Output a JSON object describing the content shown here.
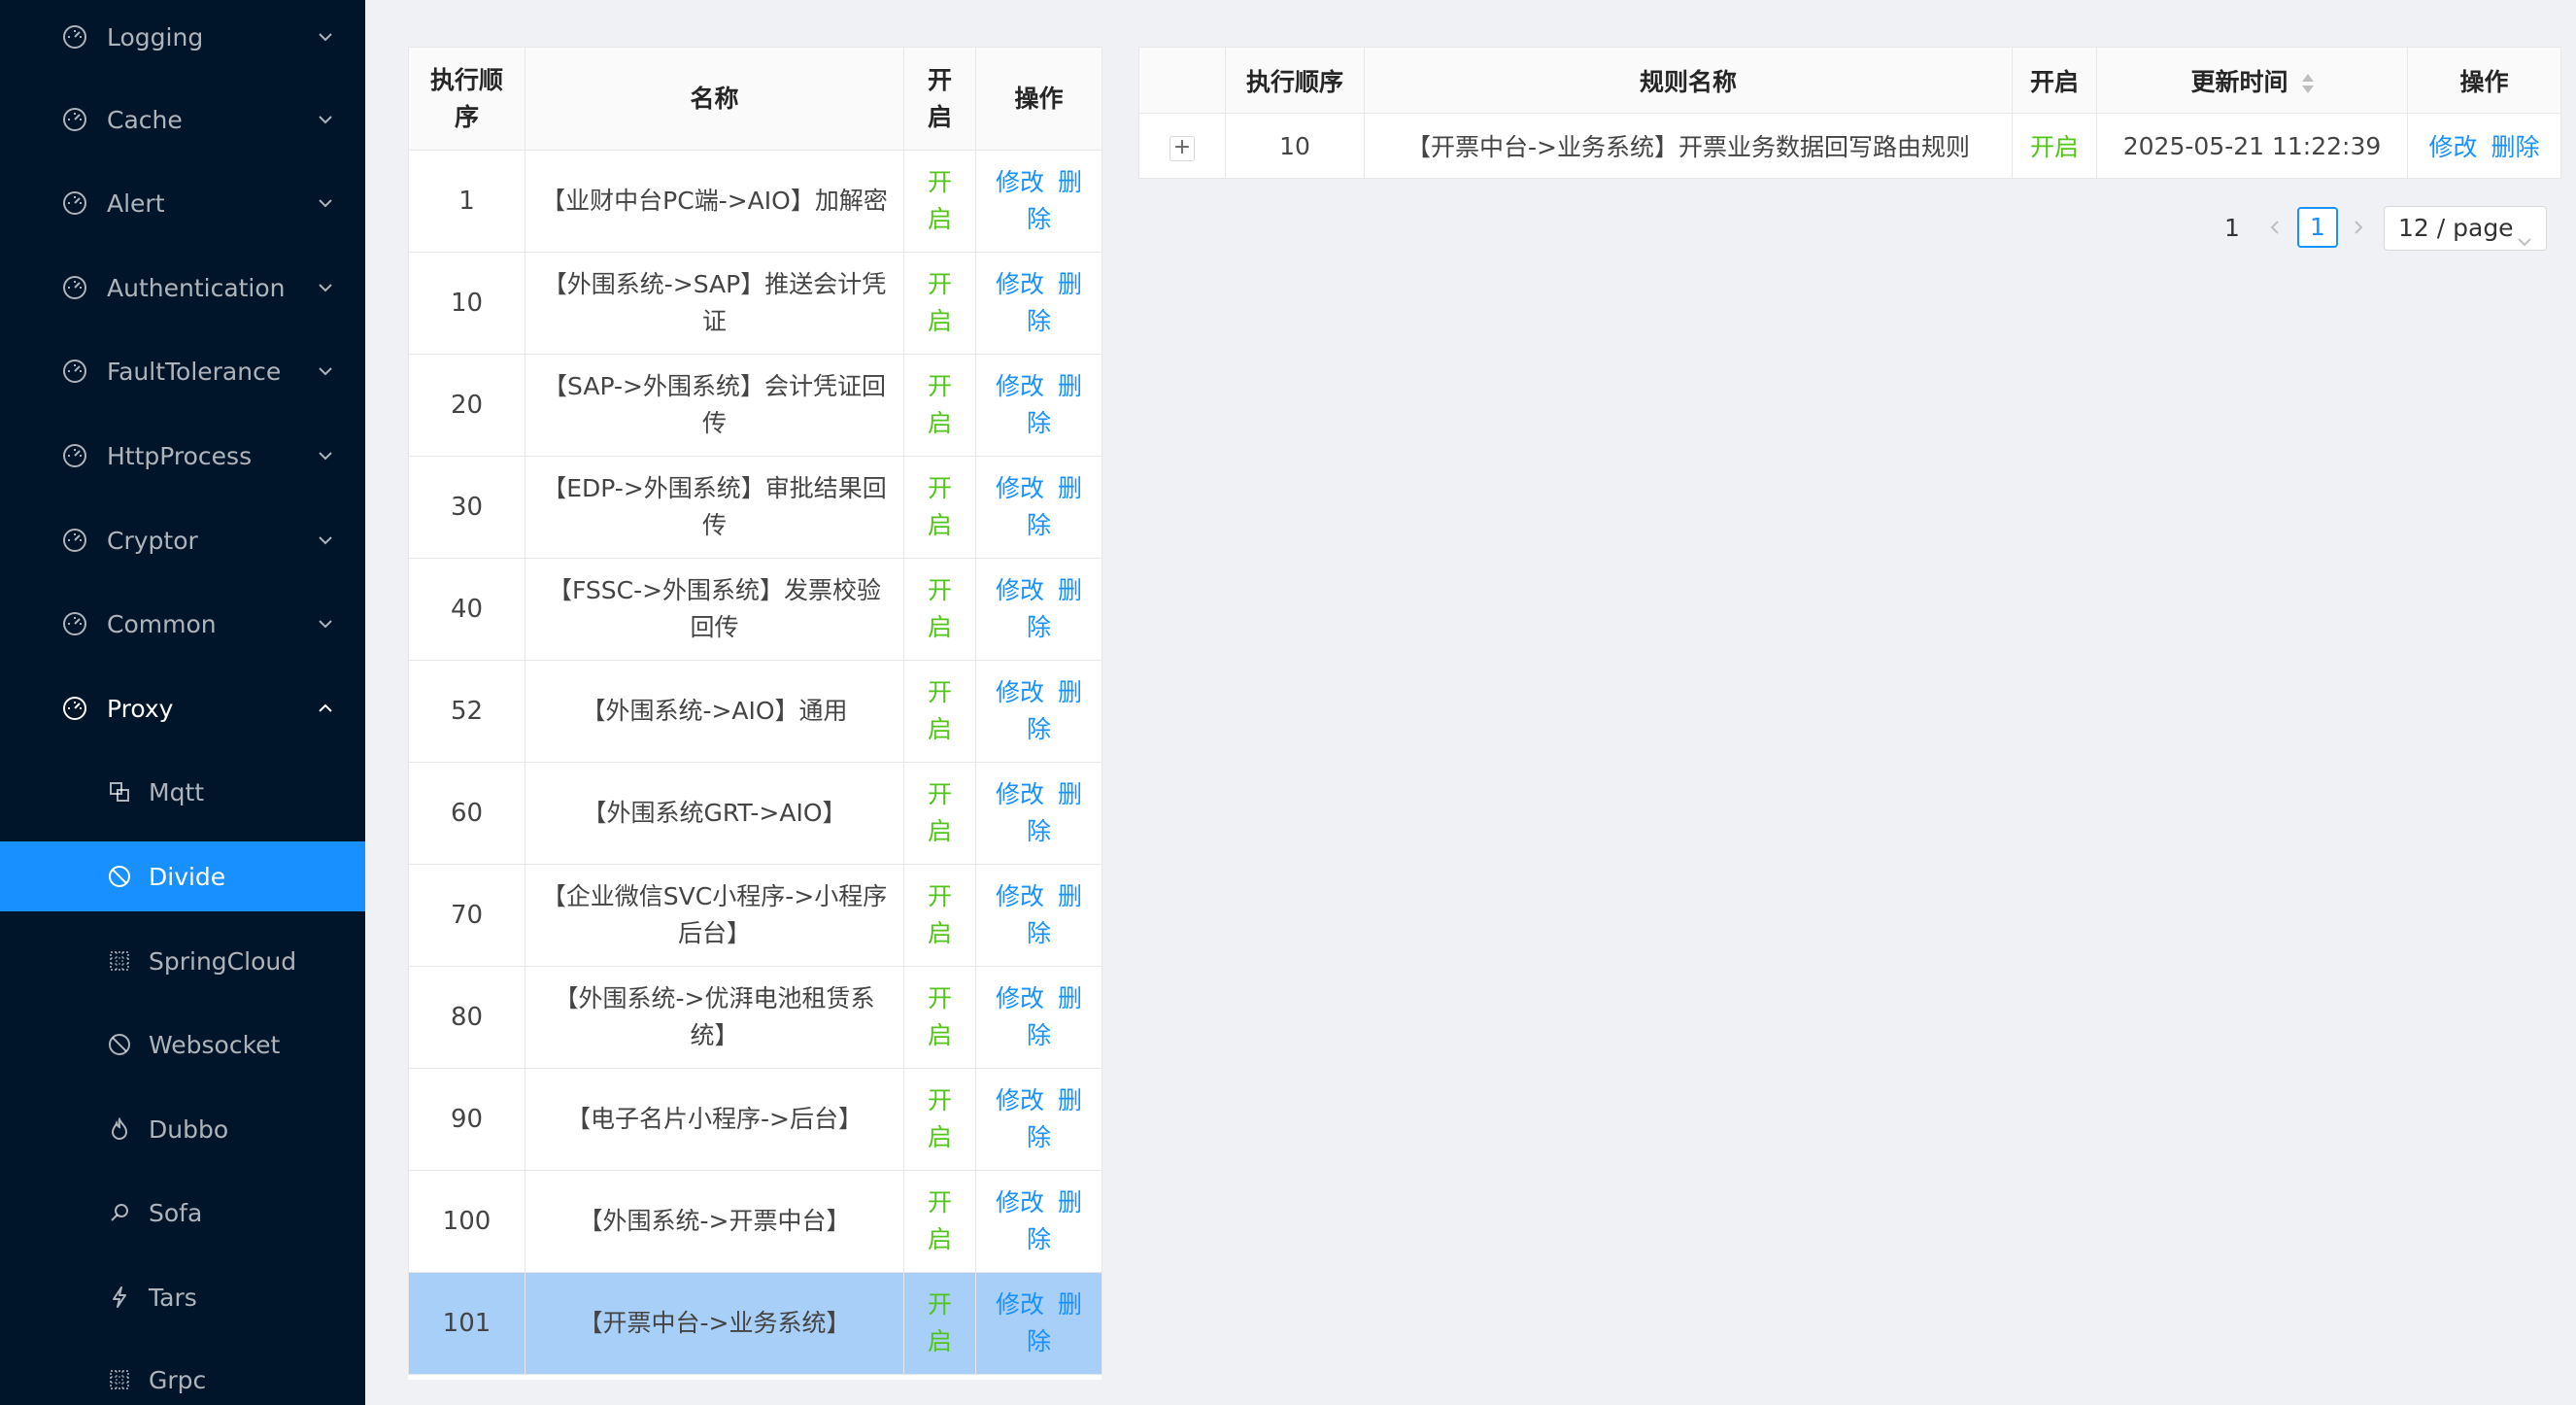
{
  "sidebar": {
    "items": [
      {
        "label": "Logging",
        "icon": "dashboard-icon"
      },
      {
        "label": "Cache",
        "icon": "dashboard-icon"
      },
      {
        "label": "Alert",
        "icon": "dashboard-icon"
      },
      {
        "label": "Authentication",
        "icon": "dashboard-icon"
      },
      {
        "label": "FaultTolerance",
        "icon": "dashboard-icon"
      },
      {
        "label": "HttpProcess",
        "icon": "dashboard-icon"
      },
      {
        "label": "Cryptor",
        "icon": "dashboard-icon"
      },
      {
        "label": "Common",
        "icon": "dashboard-icon"
      },
      {
        "label": "Proxy",
        "icon": "dashboard-icon",
        "expanded": true
      }
    ],
    "sub_items": [
      {
        "label": "Mqtt",
        "icon": "block-icon"
      },
      {
        "label": "Divide",
        "icon": "stop-icon",
        "selected": true
      },
      {
        "label": "SpringCloud",
        "icon": "grid-icon"
      },
      {
        "label": "Websocket",
        "icon": "stop-icon"
      },
      {
        "label": "Dubbo",
        "icon": "fire-icon"
      },
      {
        "label": "Sofa",
        "icon": "search-icon"
      },
      {
        "label": "Tars",
        "icon": "thunder-icon"
      },
      {
        "label": "Grpc",
        "icon": "grid-icon"
      }
    ],
    "colors": {
      "background": "#001529",
      "selected": "#1890ff"
    }
  },
  "selector_table": {
    "headers": {
      "order": "执行顺序",
      "name": "名称",
      "enabled": "开启",
      "actions": "操作"
    },
    "edit_label": "修改",
    "delete_label": "删除",
    "rows": [
      {
        "order": "1",
        "name": "【业财中台PC端->AIO】加解密",
        "enabled": "开启"
      },
      {
        "order": "10",
        "name": "【外围系统->SAP】推送会计凭证",
        "enabled": "开启"
      },
      {
        "order": "20",
        "name": "【SAP->外围系统】会计凭证回传",
        "enabled": "开启"
      },
      {
        "order": "30",
        "name": "【EDP->外围系统】审批结果回传",
        "enabled": "开启"
      },
      {
        "order": "40",
        "name": "【FSSC->外围系统】发票校验回传",
        "enabled": "开启"
      },
      {
        "order": "52",
        "name": "【外围系统->AIO】通用",
        "enabled": "开启"
      },
      {
        "order": "60",
        "name": "【外围系统GRT->AIO】",
        "enabled": "开启"
      },
      {
        "order": "70",
        "name": "【企业微信SVC小程序->小程序后台】",
        "enabled": "开启"
      },
      {
        "order": "80",
        "name": "【外围系统->优湃电池租赁系统】",
        "enabled": "开启"
      },
      {
        "order": "90",
        "name": "【电子名片小程序->后台】",
        "enabled": "开启"
      },
      {
        "order": "100",
        "name": "【外围系统->开票中台】",
        "enabled": "开启"
      },
      {
        "order": "101",
        "name": "【开票中台->业务系统】",
        "enabled": "开启",
        "selected": true
      }
    ]
  },
  "rule_table": {
    "headers": {
      "order": "执行顺序",
      "name": "规则名称",
      "enabled": "开启",
      "updated": "更新时间",
      "actions": "操作"
    },
    "expand_label": "+",
    "rows": [
      {
        "order": "10",
        "name": "【开票中台->业务系统】开票业务数据回写路由规则",
        "enabled": "开启",
        "updated": "2025-05-21 11:22:39",
        "edit": "修改",
        "delete": "删除"
      }
    ]
  },
  "pagination": {
    "total": "1",
    "current": "1",
    "page_size": "12 / page"
  },
  "colors": {
    "enabled_text": "#52c41a",
    "link": "#1890ff",
    "selected_row": "#a8cff8"
  }
}
